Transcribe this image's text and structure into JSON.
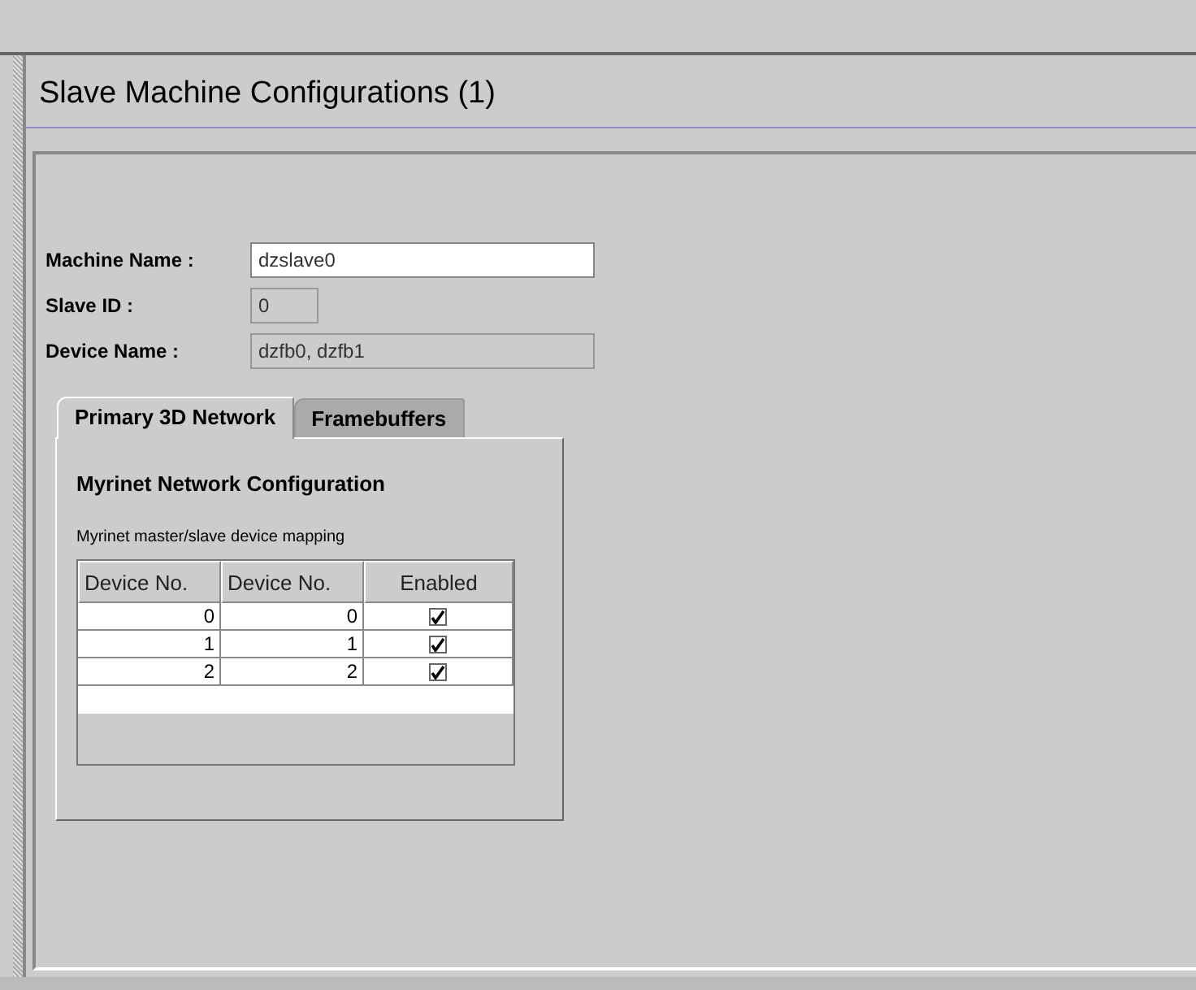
{
  "title": "Slave Machine Configurations (1)",
  "fields": [
    {
      "label": "Machine Name :",
      "value": "dzslave0",
      "disabled": false,
      "kind": "text"
    },
    {
      "label": "Slave ID :",
      "value": "0",
      "disabled": true,
      "kind": "number"
    },
    {
      "label": "Device Name :",
      "value": "dzfb0, dzfb1",
      "disabled": true,
      "kind": "text"
    }
  ],
  "tabs": [
    {
      "label": "Primary 3D Network",
      "selected": true
    },
    {
      "label": "Framebuffers",
      "selected": false
    }
  ],
  "section_title": "Myrinet Network Configuration",
  "table_caption": "Myrinet master/slave device mapping",
  "table": {
    "columns": [
      "Device No.",
      "Device No.",
      "Enabled"
    ],
    "rows": [
      {
        "master": "0",
        "slave": "0",
        "enabled": true
      },
      {
        "master": "1",
        "slave": "1",
        "enabled": true
      },
      {
        "master": "2",
        "slave": "2",
        "enabled": true
      }
    ]
  }
}
